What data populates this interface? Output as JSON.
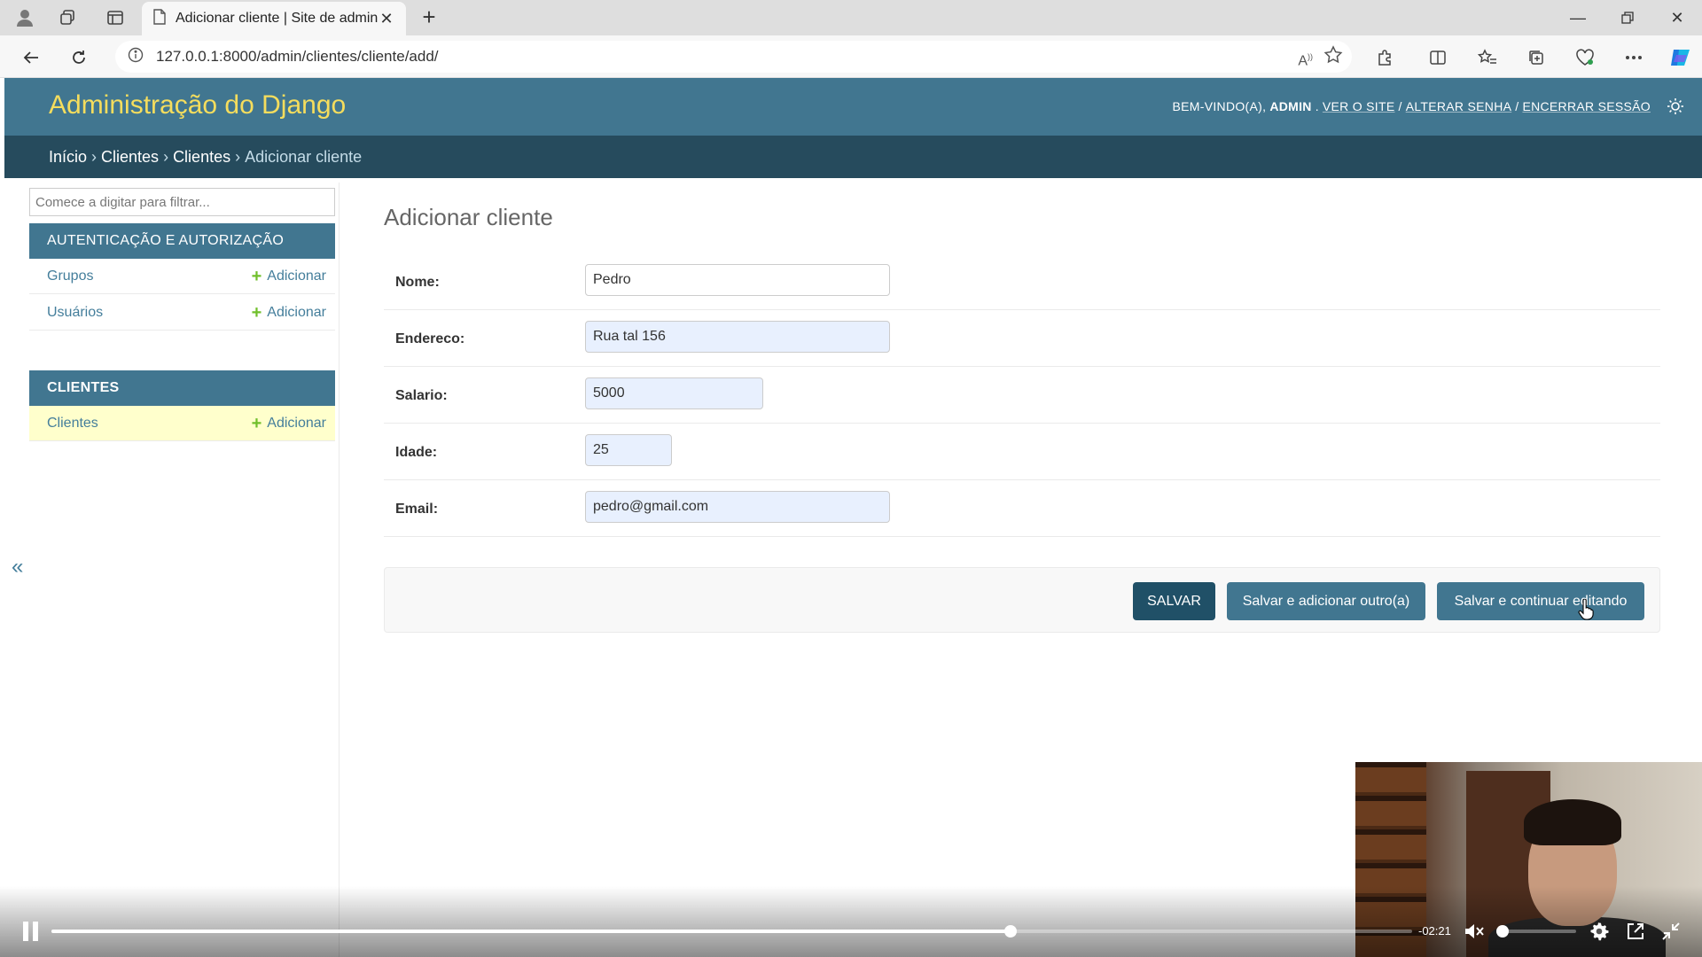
{
  "browser": {
    "tab_title": "Adicionar cliente | Site de admini",
    "url": "127.0.0.1:8000/admin/clientes/cliente/add/"
  },
  "header": {
    "site_name": "Administração do Django",
    "welcome": "BEM-VINDO(A),",
    "username": "ADMIN",
    "view_site": "VER O SITE",
    "change_password": "ALTERAR SENHA",
    "logout": "ENCERRAR SESSÃO",
    "separator": "/"
  },
  "breadcrumbs": {
    "items": [
      "Início",
      "Clientes",
      "Clientes"
    ],
    "current": "Adicionar cliente",
    "separator": "›"
  },
  "sidebar": {
    "filter_placeholder": "Comece a digitar para filtrar...",
    "modules": [
      {
        "caption": "AUTENTICAÇÃO E AUTORIZAÇÃO",
        "rows": [
          {
            "model": "Grupos",
            "add": "Adicionar"
          },
          {
            "model": "Usuários",
            "add": "Adicionar"
          }
        ]
      },
      {
        "caption": "CLIENTES",
        "rows": [
          {
            "model": "Clientes",
            "add": "Adicionar"
          }
        ]
      }
    ],
    "collapse_glyph": "«"
  },
  "form": {
    "title": "Adicionar cliente",
    "fields": [
      {
        "label": "Nome:",
        "value": "Pedro"
      },
      {
        "label": "Endereco:",
        "value": "Rua tal 156"
      },
      {
        "label": "Salario:",
        "value": "5000"
      },
      {
        "label": "Idade:",
        "value": "25"
      },
      {
        "label": "Email:",
        "value": "pedro@gmail.com"
      }
    ],
    "buttons": {
      "save": "SALVAR",
      "save_add_another": "Salvar e adicionar outro(a)",
      "save_continue": "Salvar e continuar editando"
    }
  },
  "video": {
    "time_remaining": "-02:21",
    "progress": 0.705,
    "volume": 0.0
  },
  "colors": {
    "header": "#417690",
    "breadcrumbs": "#264b5d",
    "site_name": "#f5dd5d",
    "link": "#447e9b",
    "add_plus": "#70bf2b",
    "current_row": "#ffffcc",
    "button_default": "#205067",
    "button_alt": "#417690"
  }
}
